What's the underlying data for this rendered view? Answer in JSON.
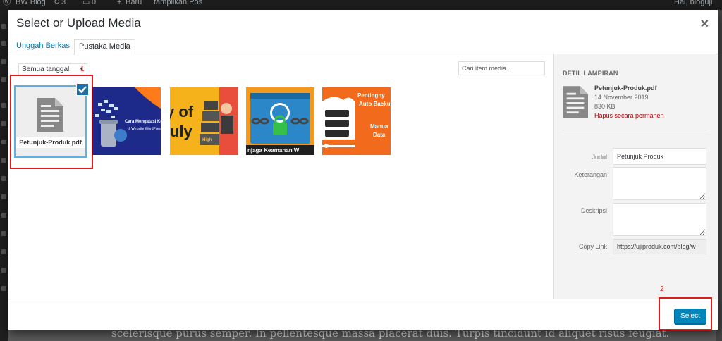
{
  "admin_bar": {
    "site_name": "BW Blog",
    "updates": "3",
    "comments": "0",
    "new_label": "Baru",
    "view_post": "tampilkan Pos",
    "greeting": "Hai, bloguji"
  },
  "background_text": "scelerisque purus semper. In pellentesque massa placerat duis. Turpis tincidunt id aliquet risus feugiat.",
  "modal": {
    "title": "Select or Upload Media",
    "close_icon": "close-icon"
  },
  "tabs": [
    {
      "label": "Unggah Berkas",
      "active": false
    },
    {
      "label": "Pustaka Media",
      "active": true
    }
  ],
  "toolbar": {
    "date_filter": "Semua tanggal",
    "search_placeholder": "Cari item media..."
  },
  "media_items": [
    {
      "type": "file",
      "filename": "Petunjuk-Produk.pdf",
      "selected": true
    },
    {
      "type": "image",
      "caption": "Cara Mengatasi Komen... di Website WordPress"
    },
    {
      "type": "image",
      "caption": "High"
    },
    {
      "type": "image",
      "caption": "njaga Keamanan W"
    },
    {
      "type": "image",
      "caption": "Pentingny Auto Backu Manua Data"
    }
  ],
  "annotations": {
    "marker_1": "1",
    "marker_2": "2"
  },
  "attachment_details": {
    "heading": "DETIL LAMPIRAN",
    "filename": "Petunjuk-Produk.pdf",
    "date": "14 November 2019",
    "size": "830 KB",
    "delete_label": "Hapus secara permanen",
    "fields": {
      "title_label": "Judul",
      "title_value": "Petunjuk Produk",
      "caption_label": "Keterangan",
      "caption_value": "",
      "description_label": "Deskripsi",
      "description_value": "",
      "link_label": "Copy Link",
      "link_value": "https://ujiproduk.com/blog/w"
    }
  },
  "footer": {
    "select_label": "Select"
  },
  "colors": {
    "primary_button": "#0085ba",
    "selection_border": "#5bb0e6",
    "annotation_red": "#e01b1b",
    "link_blue": "#0073aa",
    "delete_red": "#aa0000"
  }
}
